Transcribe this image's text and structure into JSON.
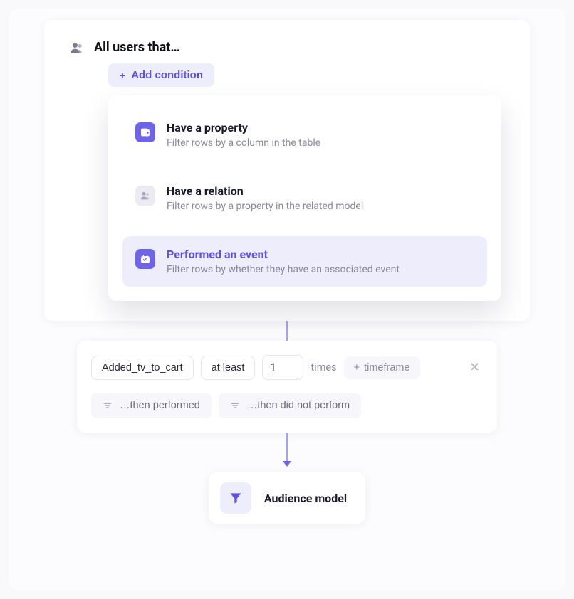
{
  "header": {
    "title": "All users that…"
  },
  "addCondition": {
    "label": "Add condition"
  },
  "options": [
    {
      "title": "Have a property",
      "desc": "Filter rows by a column in the table",
      "icon": "wallet-icon",
      "selected": false,
      "iconStyle": "purple"
    },
    {
      "title": "Have a relation",
      "desc": "Filter rows by a property in the related model",
      "icon": "users-icon",
      "selected": false,
      "iconStyle": "grey"
    },
    {
      "title": "Performed an event",
      "desc": "Filter rows by whether they have an associated event",
      "icon": "event-icon",
      "selected": true,
      "iconStyle": "purple"
    }
  ],
  "event": {
    "name": "Added_tv_to_cart",
    "operator": "at least",
    "count": "1",
    "timesLabel": "times",
    "timeframeLabel": "timeframe",
    "thenPerformed": "…then performed",
    "thenDidNotPerform": "…then did not perform"
  },
  "audience": {
    "label": "Audience model"
  }
}
